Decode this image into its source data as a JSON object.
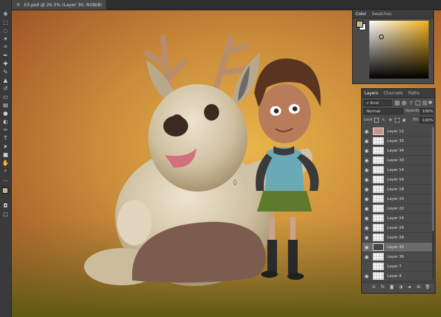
{
  "document": {
    "tab_title": "03.psd @ 26.3% (Layer 30, RGB/8)",
    "close_glyph": "×"
  },
  "toolbar": {
    "tools": [
      "move-tool-icon",
      "marquee-tool-icon",
      "lasso-tool-icon",
      "magic-wand-icon",
      "crop-tool-icon",
      "eyedropper-icon",
      "healing-brush-icon",
      "brush-tool-icon",
      "clone-stamp-icon",
      "history-brush-icon",
      "eraser-icon",
      "gradient-tool-icon",
      "blur-tool-icon",
      "dodge-tool-icon",
      "pen-tool-icon",
      "type-tool-icon",
      "path-selection-icon",
      "shape-tool-icon",
      "hand-tool-icon",
      "zoom-tool-icon",
      "more-tools-icon"
    ],
    "foreground_color": "#c9b48a",
    "background_color": "#ffffff"
  },
  "color_panel": {
    "tabs": [
      "Color",
      "Swatches"
    ],
    "active_tab": "Color",
    "hue_color": "#f5b21a"
  },
  "layers_panel": {
    "tabs": [
      "Layers",
      "Channels",
      "Paths"
    ],
    "active_tab": "Layers",
    "filter_kind": "Kind",
    "blend_mode": "Normal",
    "opacity_label": "Opacity:",
    "opacity_value": "100%",
    "lock_label": "Lock:",
    "fill_label": "Fill:",
    "fill_value": "100%",
    "layers": [
      {
        "name": "Layer 12",
        "visible": true,
        "selected": false
      },
      {
        "name": "Layer 35",
        "visible": true,
        "selected": false
      },
      {
        "name": "Layer 34",
        "visible": true,
        "selected": false
      },
      {
        "name": "Layer 33",
        "visible": true,
        "selected": false
      },
      {
        "name": "Layer 14",
        "visible": true,
        "selected": false
      },
      {
        "name": "Layer 16",
        "visible": true,
        "selected": false
      },
      {
        "name": "Layer 18",
        "visible": true,
        "selected": false
      },
      {
        "name": "Layer 20",
        "visible": true,
        "selected": false
      },
      {
        "name": "Layer 22",
        "visible": true,
        "selected": false
      },
      {
        "name": "Layer 24",
        "visible": true,
        "selected": false
      },
      {
        "name": "Layer 26",
        "visible": true,
        "selected": false
      },
      {
        "name": "Layer 28",
        "visible": true,
        "selected": false
      },
      {
        "name": "Layer 30",
        "visible": true,
        "selected": true
      },
      {
        "name": "Layer 36",
        "visible": true,
        "selected": false
      },
      {
        "name": "Layer 7",
        "visible": false,
        "selected": false
      },
      {
        "name": "Layer 4",
        "visible": true,
        "selected": false
      }
    ],
    "footer_icons": [
      "link-layers-icon",
      "fx-icon",
      "add-mask-icon",
      "adjustment-layer-icon",
      "new-group-icon",
      "new-layer-icon",
      "delete-layer-icon"
    ]
  }
}
